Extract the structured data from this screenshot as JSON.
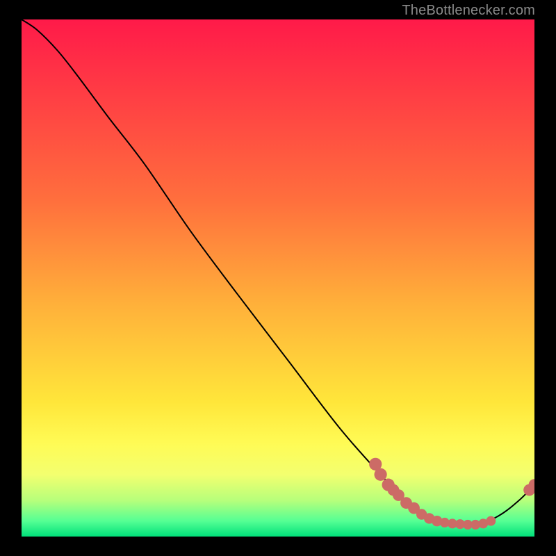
{
  "watermark": "TheBottlenecker.com",
  "chart_data": {
    "type": "line",
    "title": "",
    "xlabel": "",
    "ylabel": "",
    "xlim": [
      0,
      100
    ],
    "ylim": [
      0,
      100
    ],
    "grid": false,
    "legend": false,
    "gradient_stops": [
      {
        "offset": 0.0,
        "color": "#ff1a49"
      },
      {
        "offset": 0.35,
        "color": "#ff6f3d"
      },
      {
        "offset": 0.55,
        "color": "#ffb03a"
      },
      {
        "offset": 0.74,
        "color": "#ffe63a"
      },
      {
        "offset": 0.82,
        "color": "#fffb55"
      },
      {
        "offset": 0.88,
        "color": "#f3ff6f"
      },
      {
        "offset": 0.93,
        "color": "#b7ff7b"
      },
      {
        "offset": 0.97,
        "color": "#55ff94"
      },
      {
        "offset": 1.0,
        "color": "#00e07a"
      }
    ],
    "curve": [
      {
        "x": 0,
        "y": 100
      },
      {
        "x": 3,
        "y": 98
      },
      {
        "x": 7,
        "y": 94
      },
      {
        "x": 11,
        "y": 89
      },
      {
        "x": 17,
        "y": 81
      },
      {
        "x": 24,
        "y": 72
      },
      {
        "x": 33,
        "y": 59
      },
      {
        "x": 42,
        "y": 47
      },
      {
        "x": 52,
        "y": 34
      },
      {
        "x": 62,
        "y": 21
      },
      {
        "x": 70,
        "y": 12
      },
      {
        "x": 76,
        "y": 6
      },
      {
        "x": 82,
        "y": 3
      },
      {
        "x": 88,
        "y": 2
      },
      {
        "x": 93,
        "y": 4
      },
      {
        "x": 97,
        "y": 7
      },
      {
        "x": 100,
        "y": 10
      }
    ],
    "markers": [
      {
        "x": 69,
        "y": 14,
        "r": 1.3
      },
      {
        "x": 70,
        "y": 12,
        "r": 1.3
      },
      {
        "x": 71.5,
        "y": 10,
        "r": 1.3
      },
      {
        "x": 72.5,
        "y": 9,
        "r": 1.2
      },
      {
        "x": 73.5,
        "y": 8,
        "r": 1.2
      },
      {
        "x": 75,
        "y": 6.5,
        "r": 1.2
      },
      {
        "x": 76.5,
        "y": 5.5,
        "r": 1.2
      },
      {
        "x": 78,
        "y": 4.3,
        "r": 1.1
      },
      {
        "x": 79.5,
        "y": 3.5,
        "r": 1.1
      },
      {
        "x": 81,
        "y": 3,
        "r": 1.1
      },
      {
        "x": 82.5,
        "y": 2.7,
        "r": 1.0
      },
      {
        "x": 84,
        "y": 2.5,
        "r": 1.0
      },
      {
        "x": 85.5,
        "y": 2.4,
        "r": 1.0
      },
      {
        "x": 87,
        "y": 2.3,
        "r": 1.0
      },
      {
        "x": 88.5,
        "y": 2.3,
        "r": 1.0
      },
      {
        "x": 90,
        "y": 2.5,
        "r": 1.0
      },
      {
        "x": 91.5,
        "y": 3.0,
        "r": 1.0
      },
      {
        "x": 99,
        "y": 9.0,
        "r": 1.2
      },
      {
        "x": 100,
        "y": 10.0,
        "r": 1.2
      }
    ],
    "tiny_label": {
      "text": "",
      "x": 84.5,
      "y": 2.3
    },
    "marker_color": "#cc6b66",
    "line_color": "#000000"
  }
}
